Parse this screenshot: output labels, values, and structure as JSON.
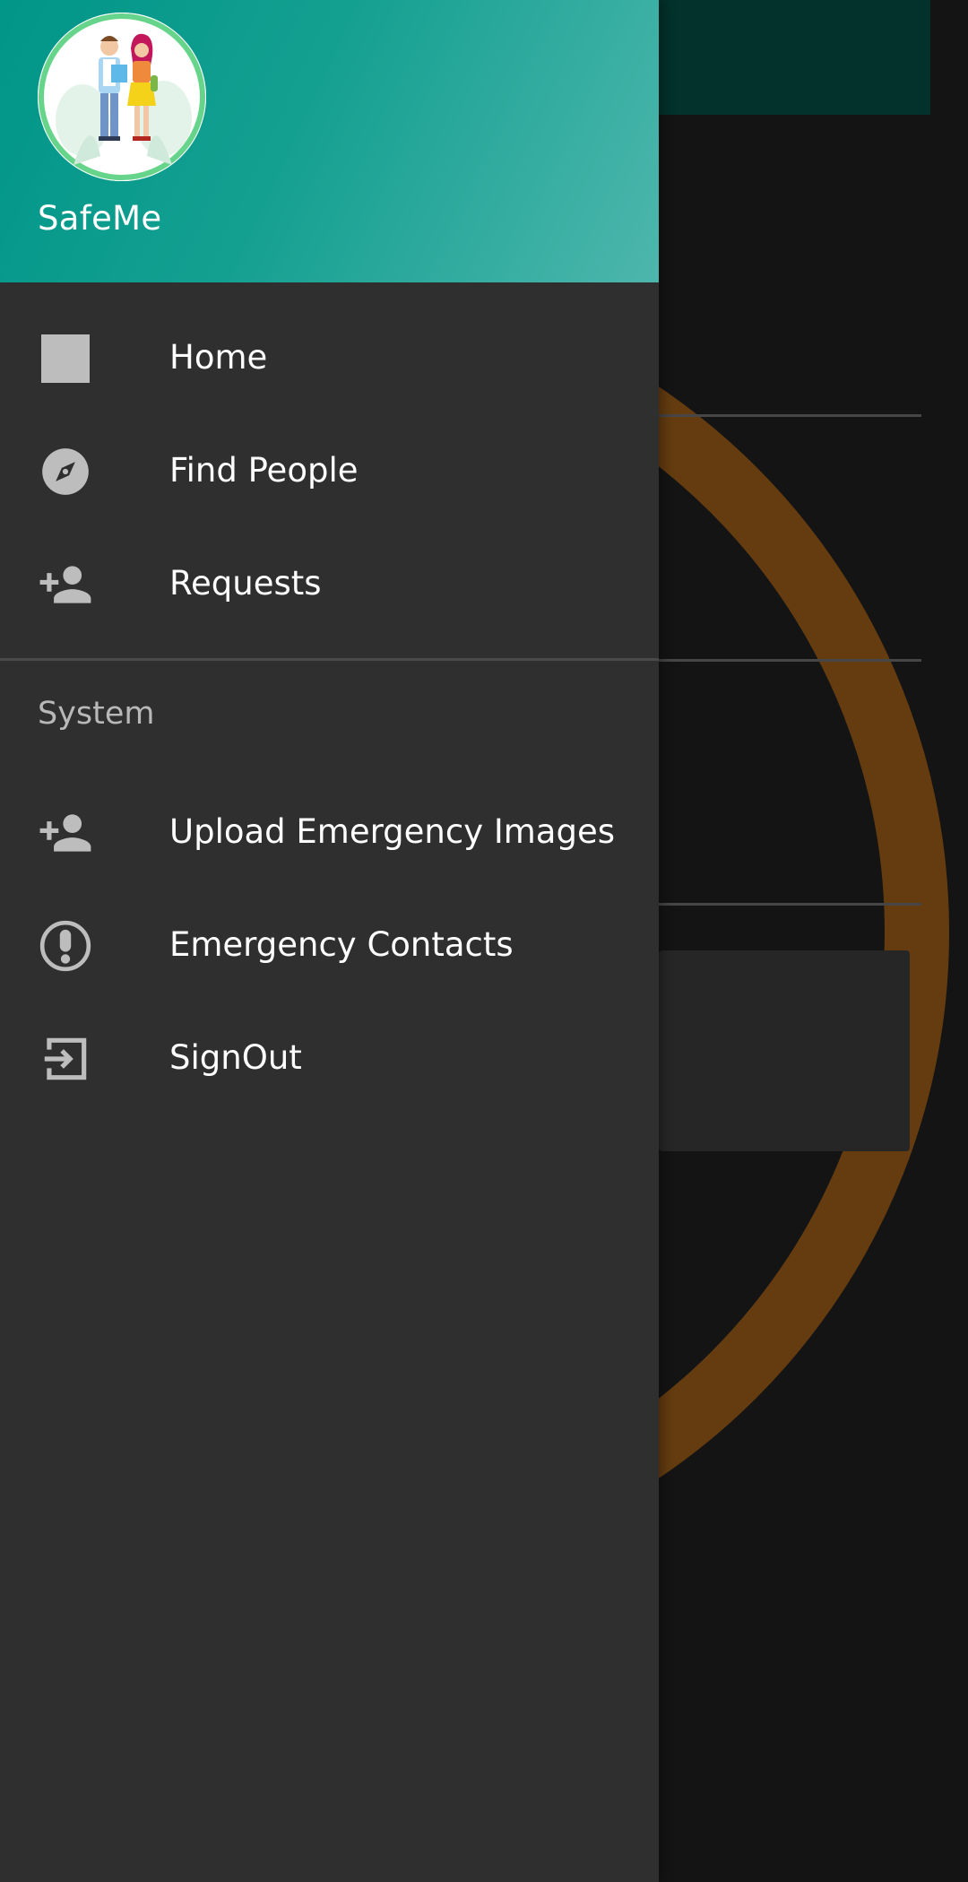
{
  "app": {
    "name": "SafeMe"
  },
  "colors": {
    "header_start": "#009688",
    "header_end": "#4db6ac",
    "drawer_bg": "#2f2f2f",
    "icon": "#bdbdbd",
    "text": "#ffffff",
    "section_text": "#b8b8b8",
    "background_ring": "#643c10"
  },
  "menu": {
    "primary": [
      {
        "label": "Home",
        "icon": "square-icon"
      },
      {
        "label": "Find People",
        "icon": "compass-icon"
      },
      {
        "label": "Requests",
        "icon": "person-add-icon"
      }
    ],
    "section_title": "System",
    "system": [
      {
        "label": "Upload Emergency Images",
        "icon": "person-add-icon"
      },
      {
        "label": "Emergency Contacts",
        "icon": "alert-circle-icon"
      },
      {
        "label": "SignOut",
        "icon": "exit-icon"
      }
    ]
  }
}
